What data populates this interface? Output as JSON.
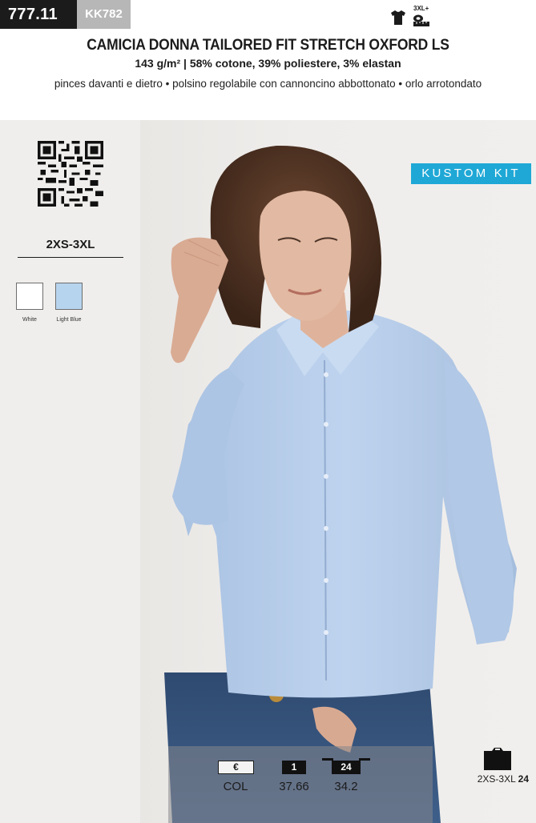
{
  "header": {
    "code_main": "777.11",
    "code_sub": "KK782",
    "badge_text": "3XL+",
    "title": "CAMICIA DONNA TAILORED FIT STRETCH OXFORD LS",
    "subtitle": "143 g/m² | 58% cotone, 39% poliestere, 3% elastan",
    "features": "pinces davanti e dietro • polsino regolabile con cannoncino abbottonato • orlo arrotondato"
  },
  "sidebar": {
    "qr_icon": "qr-code-icon",
    "sizes": "2XS-3XL",
    "colors": [
      {
        "name": "White",
        "hex": "#ffffff"
      },
      {
        "name": "Light Blue",
        "hex": "#b7d4ee"
      }
    ]
  },
  "brand": {
    "logo_text": "KUSTOM KIT",
    "color": "#1fa8d6"
  },
  "price": {
    "currency": "€",
    "col_label": "COL",
    "qty_1": "1",
    "qty_24": "24",
    "price_1": "37.66",
    "price_24": "34.2"
  },
  "packaging": {
    "sizes": "2XS-3XL",
    "pack_qty": "24"
  },
  "colors": {
    "dark": "#1b1b1b",
    "code_sub_bg": "#b7b7b7",
    "sidebar_bg": "#efeeec",
    "shirt": "#b9d0ec"
  }
}
